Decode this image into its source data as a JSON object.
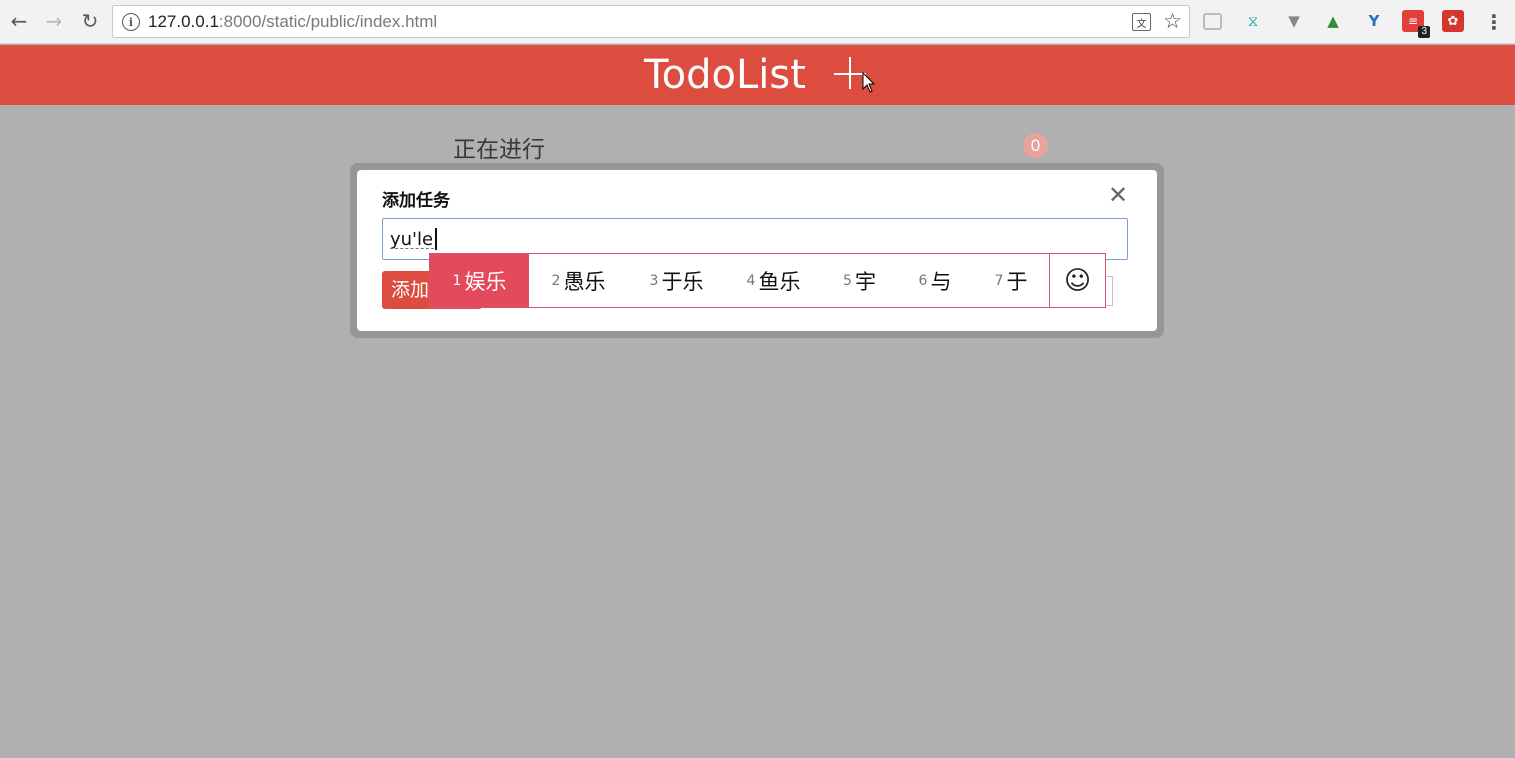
{
  "browser": {
    "back_icon": "back-arrow-icon",
    "forward_icon": "forward-arrow-icon",
    "reload_icon": "reload-icon",
    "url_host": "127.0.0.1",
    "url_rest": ":8000/static/public/index.html",
    "extension_badge": "3"
  },
  "app": {
    "title": "TodoList",
    "section_title": "正在进行",
    "count": "0",
    "accent": "#dc4c3f"
  },
  "modal": {
    "title": "添加任务",
    "input_value": "yu'le",
    "add_button": "添加任务"
  },
  "ime": {
    "candidates": [
      {
        "num": "1",
        "text": "娱乐",
        "selected": true
      },
      {
        "num": "2",
        "text": "愚乐",
        "selected": false
      },
      {
        "num": "3",
        "text": "于乐",
        "selected": false
      },
      {
        "num": "4",
        "text": "鱼乐",
        "selected": false
      },
      {
        "num": "5",
        "text": "宇",
        "selected": false
      },
      {
        "num": "6",
        "text": "与",
        "selected": false
      },
      {
        "num": "7",
        "text": "于",
        "selected": false
      }
    ],
    "emoji": "☺"
  }
}
